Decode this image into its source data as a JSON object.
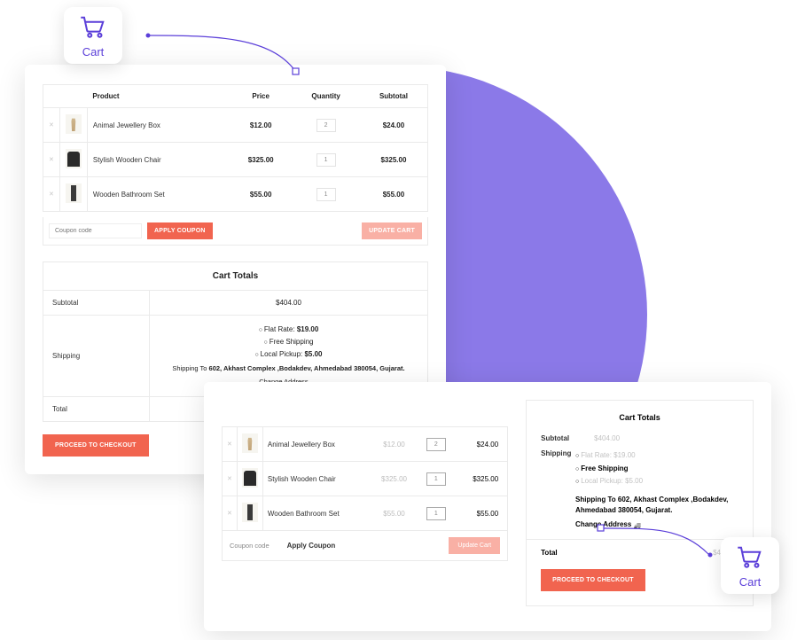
{
  "ui": {
    "cart_label": "Cart",
    "coupon_placeholder": "Coupon code",
    "apply_coupon_btn": "APPLY COUPON",
    "apply_coupon_text": "Apply Coupon",
    "update_cart_btn": "UPDATE CART",
    "update_cart_text": "Update Cart",
    "proceed_btn": "PROCEED TO CHECKOUT"
  },
  "headers": {
    "product": "Product",
    "price": "Price",
    "quantity": "Quantity",
    "subtotal": "Subtotal"
  },
  "items": [
    {
      "name": "Animal Jewellery Box",
      "price": "$12.00",
      "qty": "2",
      "subtotal": "$24.00",
      "thumb": "animal"
    },
    {
      "name": "Stylish Wooden Chair",
      "price": "$325.00",
      "qty": "1",
      "subtotal": "$325.00",
      "thumb": "chair"
    },
    {
      "name": "Wooden Bathroom Set",
      "price": "$55.00",
      "qty": "1",
      "subtotal": "$55.00",
      "thumb": "bath"
    }
  ],
  "totals": {
    "title": "Cart Totals",
    "subtotal_label": "Subtotal",
    "subtotal_value": "$404.00",
    "shipping_label": "Shipping",
    "flat_label": "Flat Rate:",
    "flat_value": "$19.00",
    "free_label": "Free Shipping",
    "local_label": "Local Pickup:",
    "local_value": "$5.00",
    "ship_to_prefix": "Shipping To",
    "ship_to_address": "602, Akhast Complex ,Bodakdev, Ahmedabad 380054, Gujarat.",
    "ship_to_address_compact": "602, Akhast Complex ,Bodakdev, Ahmedabad 380054, Gujarat.",
    "change_address": "Change Address",
    "total_label": "Total",
    "total_value": "$423.00"
  }
}
